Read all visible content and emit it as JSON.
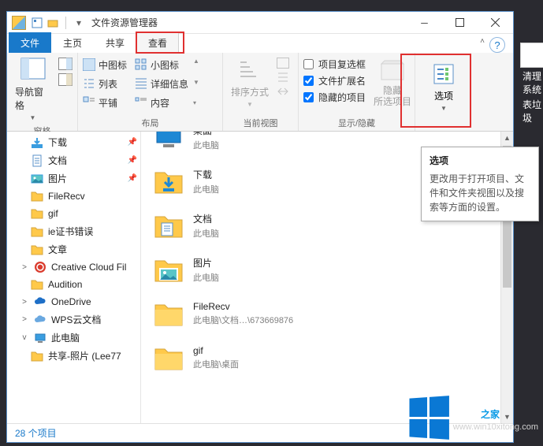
{
  "title": "文件资源管理器",
  "tabs": {
    "file": "文件",
    "home": "主页",
    "share": "共享",
    "view": "查看"
  },
  "ribbon": {
    "pane": {
      "nav": "导航窗格",
      "label": "窗格"
    },
    "layout": {
      "mid": "中图标",
      "small": "小图标",
      "list": "列表",
      "detail": "详细信息",
      "tile": "平铺",
      "content": "内容",
      "label": "布局"
    },
    "current": {
      "sort": "排序方式",
      "label": "当前视图"
    },
    "showhide": {
      "chk1": "项目复选框",
      "chk2": "文件扩展名",
      "chk3": "隐藏的项目",
      "hide": "隐藏\n所选项目",
      "label": "显示/隐藏"
    },
    "options": {
      "btn": "选项"
    }
  },
  "nav": [
    {
      "icon": "downloads",
      "label": "下载",
      "pin": true
    },
    {
      "icon": "doc",
      "label": "文档",
      "pin": true
    },
    {
      "icon": "pictures",
      "label": "图片",
      "pin": true
    },
    {
      "icon": "folder",
      "label": "FileRecv"
    },
    {
      "icon": "folder",
      "label": "gif"
    },
    {
      "icon": "folder",
      "label": "ie证书错误"
    },
    {
      "icon": "folder",
      "label": "文章"
    },
    {
      "icon": "cc",
      "label": "Creative Cloud Fil",
      "root": true,
      "exp": ">"
    },
    {
      "icon": "folder",
      "label": "Audition"
    },
    {
      "icon": "onedrive",
      "label": "OneDrive",
      "root": true,
      "exp": ">"
    },
    {
      "icon": "wps",
      "label": "WPS云文档",
      "root": true,
      "exp": ">"
    },
    {
      "icon": "pc",
      "label": "此电脑",
      "root": true,
      "exp": "v"
    },
    {
      "icon": "folder",
      "label": "共享-照片 (Lee77"
    }
  ],
  "files": [
    {
      "icon": "desktop",
      "name": "桌面",
      "sub": "此电脑",
      "cut": true
    },
    {
      "icon": "downloads-big",
      "name": "下载",
      "sub": "此电脑"
    },
    {
      "icon": "doc-big",
      "name": "文档",
      "sub": "此电脑"
    },
    {
      "icon": "pictures-big",
      "name": "图片",
      "sub": "此电脑"
    },
    {
      "icon": "folder-big",
      "name": "FileRecv",
      "sub": "此电脑\\文档…\\673669876"
    },
    {
      "icon": "folder-big",
      "name": "gif",
      "sub": "此电脑\\桌面"
    }
  ],
  "status": "28 个项目",
  "tooltip": {
    "title": "选项",
    "body": "更改用于打开项目、文件和文件夹视图以及搜索等方面的设置。"
  },
  "desktop": {
    "line1": "清理系统",
    "line2": "表垃圾"
  },
  "watermark": {
    "brand": "Win10",
    "suffix": "之家",
    "url": "www.win10xitong.com"
  }
}
